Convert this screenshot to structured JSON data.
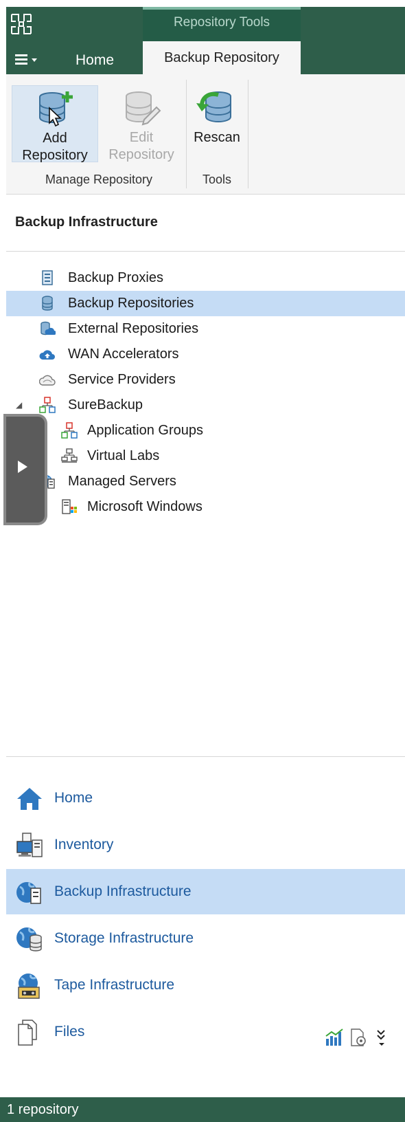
{
  "ribbon": {
    "context_group": "Repository Tools",
    "tabs": [
      {
        "label": "Home",
        "active": false
      },
      {
        "label": "Backup Repository",
        "active": true
      }
    ],
    "menu_icon": "hamburger-menu-icon",
    "buttons": {
      "add": {
        "line1": "Add",
        "line2": "Repository",
        "enabled": true
      },
      "edit": {
        "line1": "Edit",
        "line2": "Repository",
        "enabled": false
      },
      "rescan": {
        "label": "Rescan",
        "enabled": true
      }
    },
    "groups": {
      "manage": "Manage Repository",
      "tools": "Tools"
    }
  },
  "nav": {
    "title": "Backup Infrastructure",
    "items": [
      {
        "label": "Backup Proxies",
        "icon": "server-icon",
        "selected": false
      },
      {
        "label": "Backup Repositories",
        "icon": "database-icon",
        "selected": true
      },
      {
        "label": "External Repositories",
        "icon": "cloud-database-icon",
        "selected": false
      },
      {
        "label": "WAN Accelerators",
        "icon": "cloud-accelerator-icon",
        "selected": false
      },
      {
        "label": "Service Providers",
        "icon": "cloud-outline-icon",
        "selected": false
      },
      {
        "label": "SureBackup",
        "icon": "hierarchy-icon",
        "selected": false
      },
      {
        "label": "Application Groups",
        "icon": "hierarchy-icon",
        "selected": false
      },
      {
        "label": "Virtual Labs",
        "icon": "network-lab-icon",
        "selected": false
      },
      {
        "label": "Managed Servers",
        "icon": "globe-server-icon",
        "selected": false
      },
      {
        "label": "Microsoft Windows",
        "icon": "windows-server-icon",
        "selected": false
      }
    ]
  },
  "lower_nav": {
    "items": [
      {
        "label": "Home",
        "icon": "house-icon",
        "selected": false
      },
      {
        "label": "Inventory",
        "icon": "computers-icon",
        "selected": false
      },
      {
        "label": "Backup Infrastructure",
        "icon": "globe-server-icon",
        "selected": true
      },
      {
        "label": "Storage Infrastructure",
        "icon": "globe-storage-icon",
        "selected": false
      },
      {
        "label": "Tape Infrastructure",
        "icon": "globe-tape-icon",
        "selected": false
      },
      {
        "label": "Files",
        "icon": "files-icon",
        "selected": false
      }
    ]
  },
  "status": {
    "text": "1 repository"
  },
  "colors": {
    "header": "#2e5e4a",
    "selection": "#c5dcf5",
    "link": "#1d5a9e"
  }
}
